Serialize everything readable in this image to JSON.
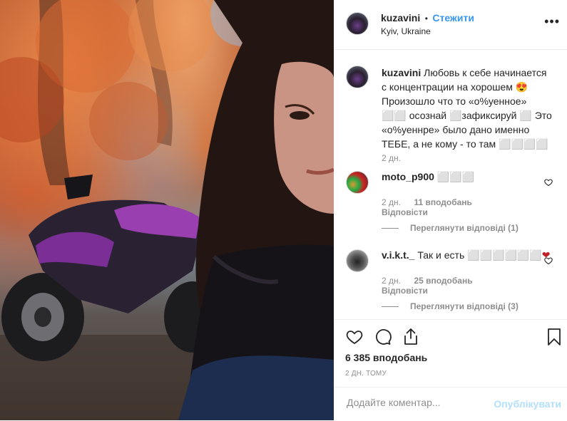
{
  "header": {
    "username": "kuzavini",
    "dot": "•",
    "follow_label": "Стежити",
    "location": "Kyiv, Ukraine",
    "more": "•••"
  },
  "caption": {
    "username": "kuzavini",
    "text": "Любовь к себе начинается с концентрации на хорошем 😍 Произошло что то «о%уенное» ⬜⬜ осознай ⬜зафиксируй ⬜ Это «о%уеннре» было дано именно ТЕБЕ, а не кому - то там ⬜⬜⬜⬜",
    "age": "2 дн."
  },
  "comments": [
    {
      "username": "moto_p900",
      "text": "⬜⬜⬜",
      "age": "2 дн.",
      "likes": "11 вподобань",
      "reply_label": "Відповісти",
      "view_replies": "Переглянути відповіді (1)"
    },
    {
      "username": "v.i.k.t._",
      "text": "Так и есть ⬜⬜⬜⬜⬜⬜❤",
      "age": "2 дн.",
      "likes": "25 вподобань",
      "reply_label": "Відповісти",
      "view_replies": "Переглянути відповіді (3)"
    }
  ],
  "actions": {
    "likes": "6 385 вподобань",
    "time": "2 дн. тому"
  },
  "add_comment": {
    "placeholder": "Додайте коментар...",
    "post_label": "Опублікувати"
  },
  "colors": {
    "accent": "#3897f0",
    "muted": "#8e8e8e",
    "heart_red": "#c21f28"
  },
  "icons": [
    "more-options-icon",
    "like-heart-icon",
    "comment-icon",
    "share-icon",
    "bookmark-icon",
    "comment-like-icon"
  ]
}
